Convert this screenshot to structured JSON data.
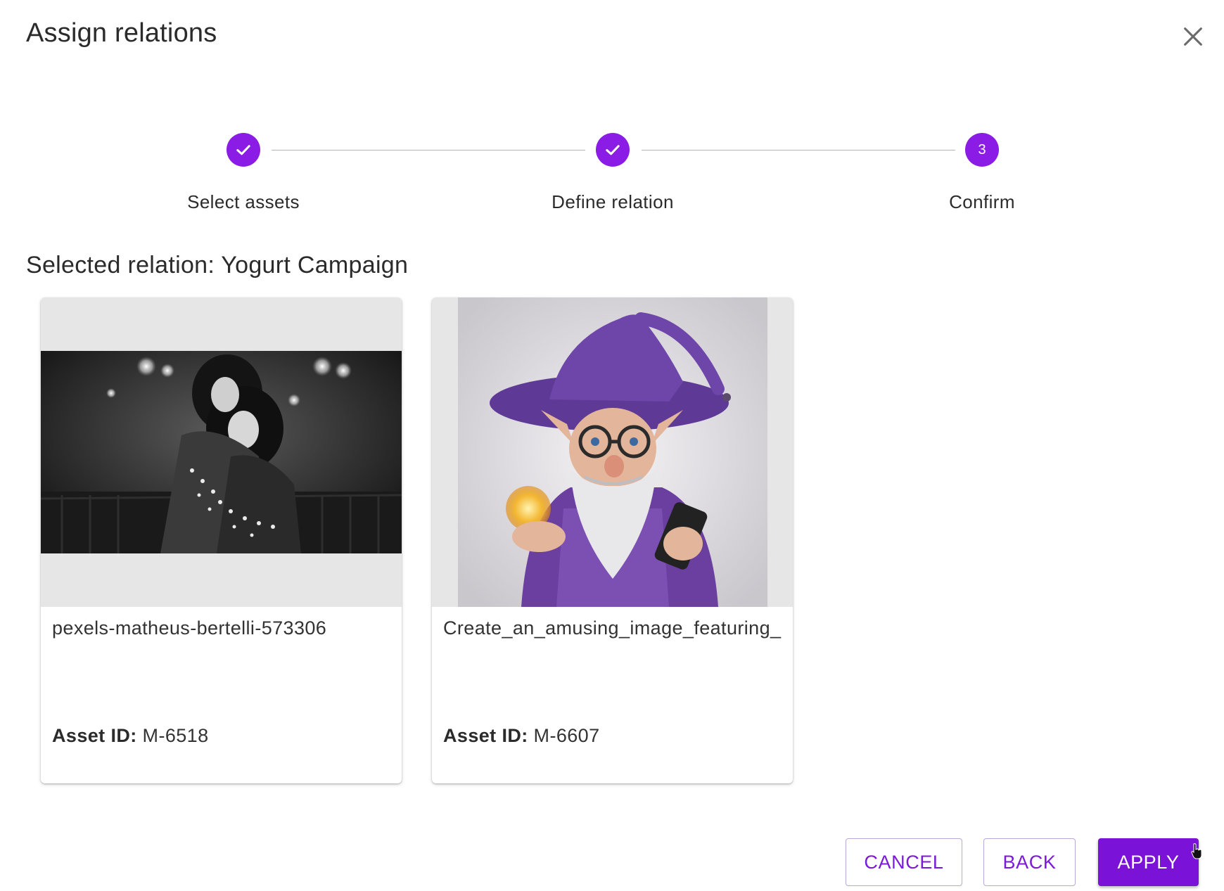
{
  "dialog": {
    "title": "Assign relations"
  },
  "stepper": {
    "steps": [
      {
        "label": "Select assets",
        "state": "completed",
        "icon": "check-icon"
      },
      {
        "label": "Define relation",
        "state": "completed",
        "icon": "check-icon"
      },
      {
        "label": "Confirm",
        "state": "active",
        "number": "3"
      }
    ]
  },
  "selected_relation": "Selected relation: Yogurt Campaign",
  "assets": [
    {
      "name": "pexels-matheus-bertelli-573306",
      "id_label": "Asset ID:",
      "id_value": "M-6518"
    },
    {
      "name": "Create_an_amusing_image_featuring_",
      "id_label": "Asset ID:",
      "id_value": "M-6607"
    }
  ],
  "buttons": {
    "cancel": "CANCEL",
    "back": "BACK",
    "apply": "APPLY"
  },
  "colors": {
    "accent": "#8a1ce6",
    "primary_button": "#7b12d8",
    "card_media_bg": "#e6e6e6"
  }
}
